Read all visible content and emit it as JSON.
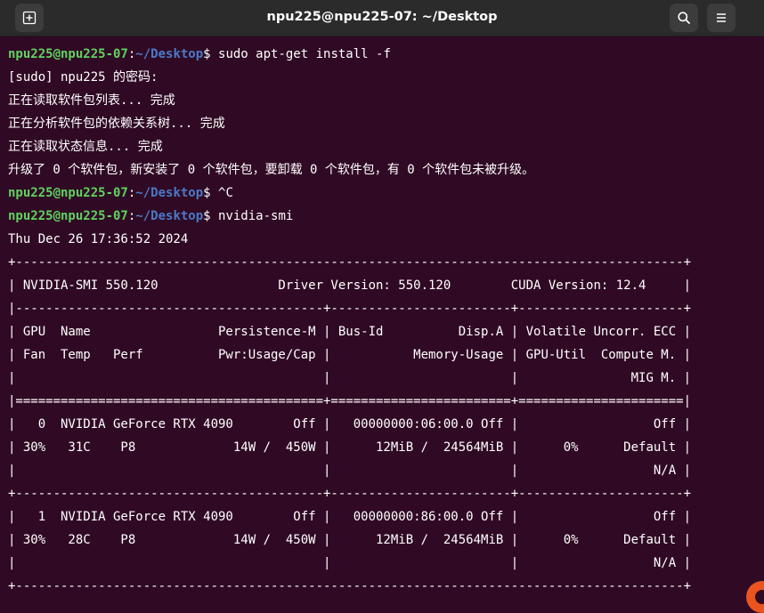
{
  "window": {
    "title": "npu225@npu225-07: ~/Desktop",
    "new_tab_icon": "new-tab-icon",
    "search_icon": "search-icon",
    "menu_icon": "hamburger-menu-icon"
  },
  "prompt": {
    "user_host": "npu225@npu225-07",
    "colon": ":",
    "path": "~/Desktop",
    "dollar": "$ "
  },
  "colors": {
    "background": "#300a24",
    "prompt_user": "#5fd35f",
    "prompt_path": "#4a79c8",
    "text": "#ffffff"
  },
  "lines": [
    {
      "type": "cmd",
      "text": "sudo apt-get install -f"
    },
    {
      "type": "out",
      "text": "[sudo] npu225 的密码:"
    },
    {
      "type": "out",
      "text": "正在读取软件包列表... 完成"
    },
    {
      "type": "out",
      "text": "正在分析软件包的依赖关系树... 完成"
    },
    {
      "type": "out",
      "text": "正在读取状态信息... 完成"
    },
    {
      "type": "out",
      "text": "升级了 0 个软件包，新安装了 0 个软件包，要卸载 0 个软件包，有 0 个软件包未被升级。"
    },
    {
      "type": "cmd",
      "text": "^C"
    },
    {
      "type": "cmd",
      "text": "nvidia-smi"
    },
    {
      "type": "out",
      "text": "Thu Dec 26 17:36:52 2024"
    },
    {
      "type": "out",
      "text": "+-----------------------------------------------------------------------------------------+"
    },
    {
      "type": "out",
      "text": "| NVIDIA-SMI 550.120                Driver Version: 550.120        CUDA Version: 12.4     |"
    },
    {
      "type": "out",
      "text": "|-----------------------------------------+------------------------+----------------------+"
    },
    {
      "type": "out",
      "text": "| GPU  Name                 Persistence-M | Bus-Id          Disp.A | Volatile Uncorr. ECC |"
    },
    {
      "type": "out",
      "text": "| Fan  Temp   Perf          Pwr:Usage/Cap |           Memory-Usage | GPU-Util  Compute M. |"
    },
    {
      "type": "out",
      "text": "|                                         |                        |               MIG M. |"
    },
    {
      "type": "out",
      "text": "|=========================================+========================+======================|"
    },
    {
      "type": "out",
      "text": "|   0  NVIDIA GeForce RTX 4090        Off |   00000000:06:00.0 Off |                  Off |"
    },
    {
      "type": "out",
      "text": "| 30%   31C    P8             14W /  450W |      12MiB /  24564MiB |      0%      Default |"
    },
    {
      "type": "out",
      "text": "|                                         |                        |                  N/A |"
    },
    {
      "type": "out",
      "text": "+-----------------------------------------+------------------------+----------------------+"
    },
    {
      "type": "out",
      "text": "|   1  NVIDIA GeForce RTX 4090        Off |   00000000:86:00.0 Off |                  Off |"
    },
    {
      "type": "out",
      "text": "| 30%   28C    P8             14W /  450W |      12MiB /  24564MiB |      0%      Default |"
    },
    {
      "type": "out",
      "text": "|                                         |                        |                  N/A |"
    },
    {
      "type": "out",
      "text": "+-----------------------------------------------------------------------------------------+"
    }
  ]
}
